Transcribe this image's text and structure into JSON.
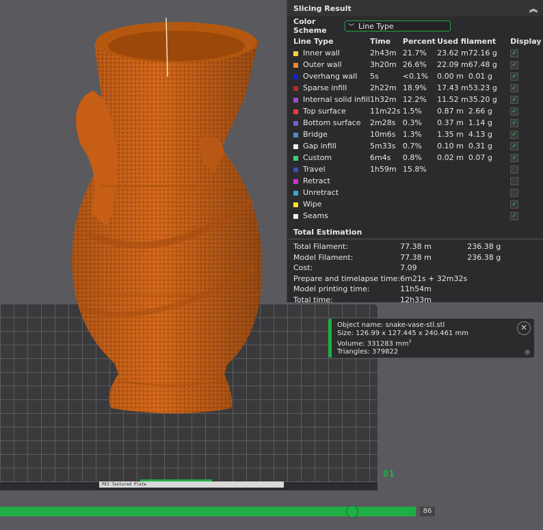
{
  "panel": {
    "title": "Slicing Result",
    "color_scheme_label": "Color Scheme",
    "color_scheme_value": "Line Type",
    "columns": [
      "Line Type",
      "Time",
      "Percent",
      "Used filament",
      "Display"
    ],
    "rows": [
      {
        "name": "Inner wall",
        "color": "#f5d33b",
        "time": "2h43m",
        "percent": "21.7%",
        "len": "23.62 m",
        "grams": "72.16 g",
        "display": true
      },
      {
        "name": "Outer wall",
        "color": "#f08a2a",
        "time": "3h20m",
        "percent": "26.6%",
        "len": "22.09 m",
        "grams": "67.48 g",
        "display": true
      },
      {
        "name": "Overhang wall",
        "color": "#1a1ae6",
        "time": "5s",
        "percent": "<0.1%",
        "len": "0.00 m",
        "grams": "0.01 g",
        "display": true
      },
      {
        "name": "Sparse infill",
        "color": "#b52a2a",
        "time": "2h22m",
        "percent": "18.9%",
        "len": "17.43 m",
        "grams": "53.23 g",
        "display": true
      },
      {
        "name": "Internal solid infill",
        "color": "#9a4fc7",
        "time": "1h32m",
        "percent": "12.2%",
        "len": "11.52 m",
        "grams": "35.20 g",
        "display": true
      },
      {
        "name": "Top surface",
        "color": "#e63c3c",
        "time": "11m22s",
        "percent": "1.5%",
        "len": "0.87 m",
        "grams": "2.66 g",
        "display": true
      },
      {
        "name": "Bottom surface",
        "color": "#7a5ad1",
        "time": "2m28s",
        "percent": "0.3%",
        "len": "0.37 m",
        "grams": "1.14 g",
        "display": true
      },
      {
        "name": "Bridge",
        "color": "#5a86c8",
        "time": "10m6s",
        "percent": "1.3%",
        "len": "1.35 m",
        "grams": "4.13 g",
        "display": true
      },
      {
        "name": "Gap infill",
        "color": "#f2f2f2",
        "time": "5m33s",
        "percent": "0.7%",
        "len": "0.10 m",
        "grams": "0.31 g",
        "display": true
      },
      {
        "name": "Custom",
        "color": "#3bd17a",
        "time": "6m4s",
        "percent": "0.8%",
        "len": "0.02 m",
        "grams": "0.07 g",
        "display": true
      },
      {
        "name": "Travel",
        "color": "#3b4fa8",
        "time": "1h59m",
        "percent": "15.8%",
        "len": "",
        "grams": "",
        "display": false
      },
      {
        "name": "Retract",
        "color": "#d12fd1",
        "time": "",
        "percent": "",
        "len": "",
        "grams": "",
        "display": false
      },
      {
        "name": "Unretract",
        "color": "#3aa8c9",
        "time": "",
        "percent": "",
        "len": "",
        "grams": "",
        "display": false
      },
      {
        "name": "Wipe",
        "color": "#f2e52a",
        "time": "",
        "percent": "",
        "len": "",
        "grams": "",
        "display": true
      },
      {
        "name": "Seams",
        "color": "#f2f2f2",
        "time": "",
        "percent": "",
        "len": "",
        "grams": "",
        "display": true
      }
    ],
    "total_title": "Total Estimation",
    "totals": [
      {
        "k": "Total Filament:",
        "v1": "77.38 m",
        "v2": "236.38 g"
      },
      {
        "k": "Model Filament:",
        "v1": "77.38 m",
        "v2": "236.38 g"
      },
      {
        "k": "Cost:",
        "v1": "7.09",
        "v2": ""
      },
      {
        "k": "Prepare and timelapse time:",
        "v1": "6m21s + 32m32s",
        "v2": ""
      },
      {
        "k": "Model printing time:",
        "v1": "11h54m",
        "v2": ""
      },
      {
        "k": "Total time:",
        "v1": "12h33m",
        "v2": ""
      }
    ]
  },
  "object": {
    "name_line": "Object name: snake-vase-stl.stl",
    "size_line": "Size: 126.99 x 127.445 x 240.461 mm",
    "volume_line": "Volume: 331283 mm",
    "volume_sup": "3",
    "triangles_line": "Triangles: 379822"
  },
  "bed": {
    "plate_number": "01",
    "plate_label": "PEI Textured Plate"
  },
  "slider": {
    "value": "86",
    "fraction": 0.86
  },
  "colors": {
    "accent": "#1fae45",
    "model": "#d4691d"
  }
}
